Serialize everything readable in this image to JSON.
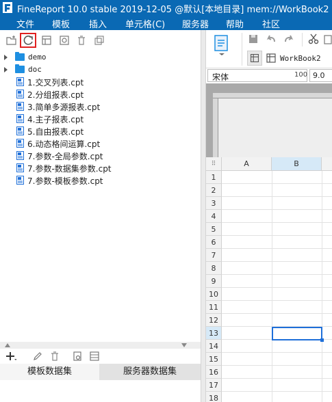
{
  "window": {
    "title": "FineReport 10.0 stable 2019-12-05 @默认[本地目录]    mem://WorkBook2"
  },
  "menu": [
    "文件",
    "模板",
    "插入",
    "单元格(C)",
    "服务器",
    "帮助",
    "社区"
  ],
  "tree": {
    "folders": [
      "demo",
      "doc"
    ],
    "files": [
      {
        "label": "1.交叉列表.cpt"
      },
      {
        "label": "2.分组报表.cpt"
      },
      {
        "label": "3.简单多源报表.cpt"
      },
      {
        "label": "4.主子报表.cpt"
      },
      {
        "label": "5.自由报表.cpt"
      },
      {
        "label": "6.动态格间运算.cpt"
      },
      {
        "label": "7.参数-全局参数.cpt"
      },
      {
        "label": "7.参数-数据集参数.cpt"
      },
      {
        "label": "7.参数-模板参数.cpt"
      }
    ]
  },
  "bottom_tabs": [
    "模板数据集",
    "服务器数据集"
  ],
  "editor": {
    "tab_label": "WorkBook2",
    "font_name": "宋体",
    "font_size": "9.0",
    "zoom": "100",
    "columns": [
      "A",
      "B"
    ],
    "rows": [
      "1",
      "2",
      "3",
      "4",
      "5",
      "6",
      "7",
      "8",
      "9",
      "10",
      "11",
      "12",
      "13",
      "14",
      "15",
      "16",
      "17",
      "18"
    ],
    "selected_cell": "B13"
  },
  "colors": {
    "titlebar": "#0a69b4",
    "highlight": "#e02020",
    "selection": "#1e6fd9"
  }
}
